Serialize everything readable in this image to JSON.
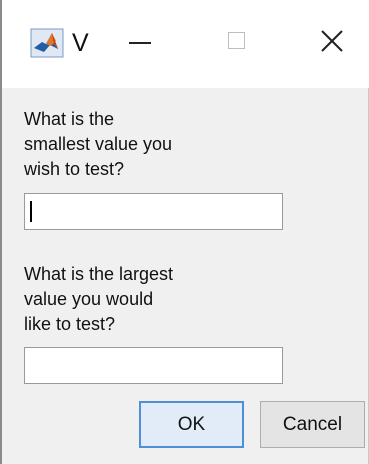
{
  "window": {
    "title": "V",
    "icons": {
      "app": "matlab-logo-icon",
      "minimize": "minimize-icon",
      "maximize": "maximize-icon",
      "close": "close-icon"
    }
  },
  "form": {
    "prompt_min": "What is the\nsmallest value you\nwish to test?",
    "prompt_max": "What is the largest\nvalue you would\nlike to test?",
    "min_value": "",
    "max_value": ""
  },
  "buttons": {
    "ok_label": "OK",
    "cancel_label": "Cancel"
  },
  "colors": {
    "dialog_background": "#f0f0f0",
    "titlebar_background": "#ffffff",
    "ok_border": "#4f8fd6",
    "ok_fill": "#e1ecf8"
  }
}
